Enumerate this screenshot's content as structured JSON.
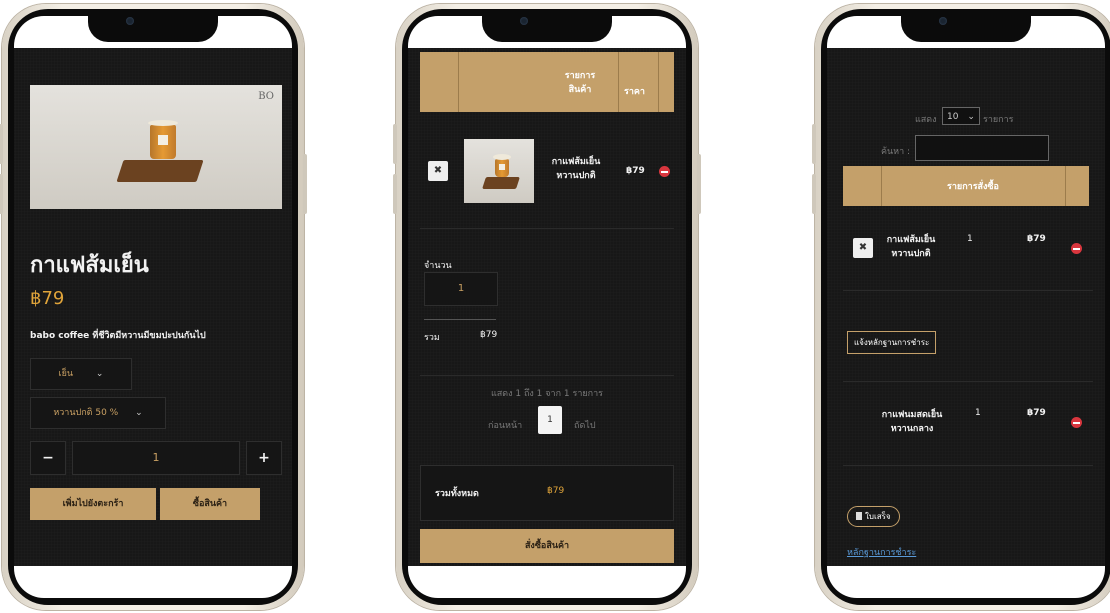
{
  "product_screen": {
    "brand_mark": "BO",
    "product_name": "กาแฟส้มเย็น",
    "price": "฿79",
    "description": "babo coffee ที่ชีวิตมีหวานมีขมปะปนกันไป",
    "temp_select": "เย็น",
    "sweet_select": "หวานปกติ 50 %",
    "quantity": "1",
    "minus_label": "−",
    "plus_label": "+",
    "add_to_cart_label": "เพิ่มไปยังตะกร้า",
    "buy_label": "ซื้อสินค้า"
  },
  "cart_screen": {
    "header_items": "รายการ\nสินค้า",
    "header_price": "ราคา",
    "item_name": "กาแฟส้มเย็น\nหวานปกติ",
    "item_price": "฿79",
    "remove_label": "✖",
    "qty_label": "จำนวน",
    "qty_value": "1",
    "subtotal_label": "รวม",
    "subtotal_value": "฿79",
    "info_text": "แสดง 1 ถึง 1 จาก 1 รายการ",
    "prev_label": "ก่อนหน้า",
    "page_num": "1",
    "next_label": "ถัดไป",
    "total_label": "รวมทั้งหมด",
    "total_value": "฿79",
    "checkout_label": "สั่งซื้อสินค้า"
  },
  "order_screen": {
    "show_label": "แสดง",
    "show_value": "10",
    "show_unit": "รายการ",
    "search_label": "ค้นหา :",
    "header_label": "รายการสั่งซื้อ",
    "rows": [
      {
        "name": "กาแฟส้มเย็น\nหวานปกติ",
        "qty": "1",
        "price": "฿79"
      },
      {
        "name": "กาแฟนมสดเย็น\nหวานกลาง",
        "qty": "1",
        "price": "฿79"
      }
    ],
    "remove_label": "✖",
    "payment_proof_button": "แจ้งหลักฐานการชำระ",
    "receipt_button": "ใบเสร็จ",
    "payment_link": "หลักฐานการชำระ"
  },
  "colors": {
    "accent": "#c4a06a",
    "price_text": "#e0a43a",
    "background": "#171717",
    "remove": "#d9363e"
  }
}
